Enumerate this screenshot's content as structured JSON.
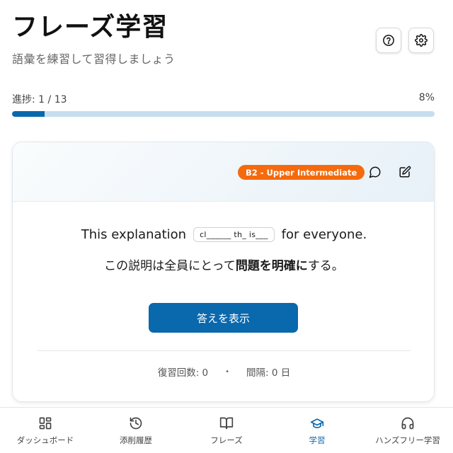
{
  "header": {
    "title": "フレーズ学習",
    "subtitle": "語彙を練習して習得しましょう"
  },
  "toolbar": {
    "help_icon": "help-circle-icon",
    "settings_icon": "gear-icon"
  },
  "progress": {
    "label": "進捗: 1 / 13",
    "percent_label": "8%",
    "fraction": 0.077
  },
  "card": {
    "level_badge": "B2 - Upper Intermediate",
    "sentence_en_before": "This explanation",
    "blank_hint": "cl______ th_ is___",
    "sentence_en_after": "for everyone.",
    "sentence_ja_before": "この説明は全員にとって",
    "sentence_ja_bold": "問題を明確に",
    "sentence_ja_after": "する。",
    "answer_button": "答えを表示",
    "review_count": "復習回数: 0",
    "interval": "間隔: 0 日",
    "separator": "•"
  },
  "nav": {
    "items": [
      {
        "label": "ダッシュボード",
        "icon": "dashboard-grid-icon"
      },
      {
        "label": "添削履歴",
        "icon": "history-icon"
      },
      {
        "label": "フレーズ",
        "icon": "book-open-icon"
      },
      {
        "label": "学習",
        "icon": "graduation-cap-icon"
      },
      {
        "label": "ハンズフリー学習",
        "icon": "headphones-icon"
      }
    ],
    "active_index": 3
  },
  "colors": {
    "accent": "#0a68ad",
    "badge": "#f46a0d",
    "progress_track": "#c6def0"
  }
}
